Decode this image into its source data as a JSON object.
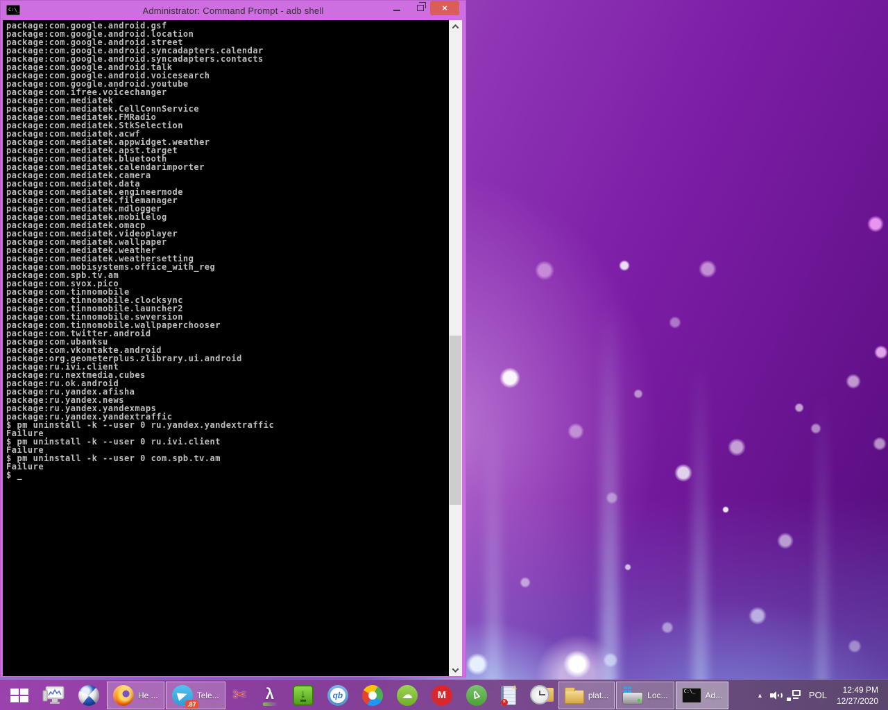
{
  "colors": {
    "titlebar_bg": "#cf6ee0",
    "close_button_bg": "#d95d58",
    "terminal_bg": "#000000",
    "terminal_fg": "#bfbfbf",
    "taskbar_purple": "#8b3c98",
    "badge_bg": "#e8503a",
    "scrollbar_track": "#f1f1f1",
    "scrollbar_thumb": "#cdcdcd"
  },
  "window": {
    "title": "Administrator: Command Prompt - adb  shell",
    "icon_text": "C:\\_",
    "controls": {
      "minimize": "minimize",
      "restore": "restore",
      "close": "×"
    }
  },
  "terminal": {
    "lines": [
      "package:com.google.android.gsf",
      "package:com.google.android.location",
      "package:com.google.android.street",
      "package:com.google.android.syncadapters.calendar",
      "package:com.google.android.syncadapters.contacts",
      "package:com.google.android.talk",
      "package:com.google.android.voicesearch",
      "package:com.google.android.youtube",
      "package:com.ifree.voicechanger",
      "package:com.mediatek",
      "package:com.mediatek.CellConnService",
      "package:com.mediatek.FMRadio",
      "package:com.mediatek.StkSelection",
      "package:com.mediatek.acwf",
      "package:com.mediatek.appwidget.weather",
      "package:com.mediatek.apst.target",
      "package:com.mediatek.bluetooth",
      "package:com.mediatek.calendarimporter",
      "package:com.mediatek.camera",
      "package:com.mediatek.data",
      "package:com.mediatek.engineermode",
      "package:com.mediatek.filemanager",
      "package:com.mediatek.mdlogger",
      "package:com.mediatek.mobilelog",
      "package:com.mediatek.omacp",
      "package:com.mediatek.videoplayer",
      "package:com.mediatek.wallpaper",
      "package:com.mediatek.weather",
      "package:com.mediatek.weathersetting",
      "package:com.mobisystems.office_with_reg",
      "package:com.spb.tv.am",
      "package:com.svox.pico",
      "package:com.tinnomobile",
      "package:com.tinnomobile.clocksync",
      "package:com.tinnomobile.launcher2",
      "package:com.tinnomobile.swversion",
      "package:com.tinnomobile.wallpaperchooser",
      "package:com.twitter.android",
      "package:com.ubanksu",
      "package:com.vkontakte.android",
      "package:org.geometerplus.zlibrary.ui.android",
      "package:ru.ivi.client",
      "package:ru.nextmedia.cubes",
      "package:ru.ok.android",
      "package:ru.yandex.afisha",
      "package:ru.yandex.news",
      "package:ru.yandex.yandexmaps",
      "package:ru.yandex.yandextraffic",
      "$ pm uninstall -k --user 0 ru.yandex.yandextraffic",
      "Failure",
      "$ pm uninstall -k --user 0 ru.ivi.client",
      "Failure",
      "$ pm uninstall -k --user 0 com.spb.tv.am",
      "Failure",
      "$ _"
    ]
  },
  "taskbar": {
    "apps": {
      "firefox_label": "He ...",
      "telegram_label": "Tele...",
      "telegram_badge": ".87",
      "folder_label": "plat...",
      "disk_label": "Loc...",
      "cmd_label": "Ad...",
      "qb_text": "qb",
      "mega_text": "M",
      "lambda_text": "λ",
      "scissors_glyph": "✂",
      "cloud_glyph": "☁",
      "triangle_glyph": "∆",
      "jd_arrow": "↓",
      "notebook_warn": "⚠",
      "notebook_err": "×",
      "cmd_icon_text": "C:\\_"
    },
    "tray": {
      "language": "POL",
      "time": "12:49 PM",
      "date": "12/27/2020"
    }
  }
}
